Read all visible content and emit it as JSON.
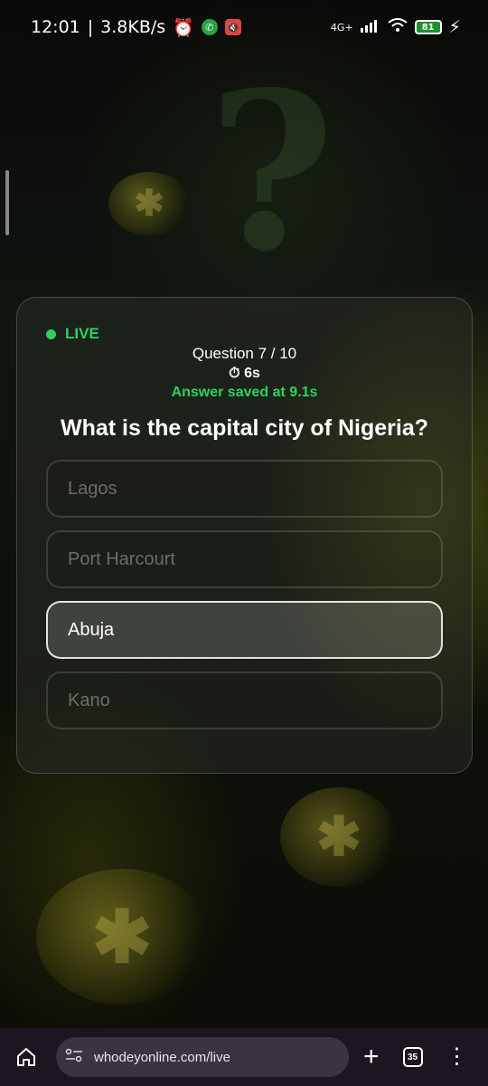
{
  "status_bar": {
    "time": "12:01",
    "network_speed": "3.8KB/s",
    "network_type": "4G+",
    "battery": "81",
    "icons": [
      "alarm-icon",
      "whatsapp-icon",
      "mute-icon",
      "signal-icon",
      "wifi-icon",
      "battery-icon",
      "charging-icon"
    ]
  },
  "quiz": {
    "live_label": "LIVE",
    "progress": "Question 7 / 10",
    "timer": "6s",
    "saved_message": "Answer saved at 9.1s",
    "question": "What is the capital city of Nigeria?",
    "options": [
      {
        "label": "Lagos",
        "selected": false
      },
      {
        "label": "Port Harcourt",
        "selected": false
      },
      {
        "label": "Abuja",
        "selected": true
      },
      {
        "label": "Kano",
        "selected": false
      }
    ]
  },
  "browser": {
    "url": "whodeyonline.com/live",
    "tab_count": "35"
  },
  "colors": {
    "live_green": "#2fd15e",
    "card_bg": "#282c24",
    "browser_bar": "#1b1620"
  }
}
